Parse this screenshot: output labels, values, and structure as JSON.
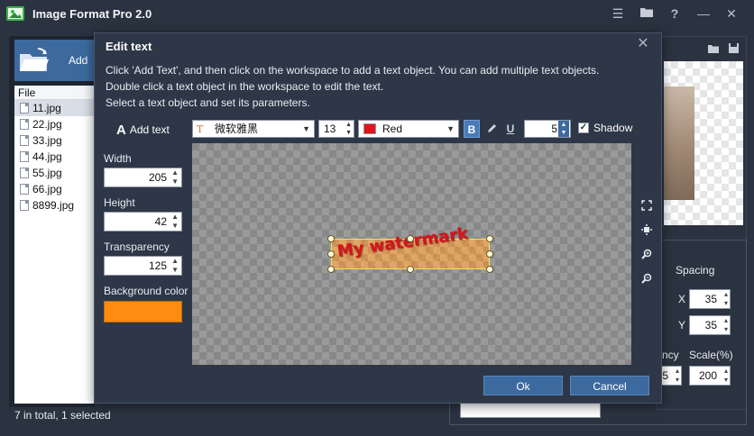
{
  "app": {
    "title": "Image Format Pro 2.0"
  },
  "main": {
    "add_label": "Add",
    "file_header": "File",
    "files": [
      "11.jpg",
      "22.jpg",
      "33.jpg",
      "44.jpg",
      "55.jpg",
      "66.jpg",
      "8899.jpg"
    ],
    "selected_file": "11.jpg",
    "status": "7 in total, 1 selected"
  },
  "right_panel": {
    "spacing_label": "Spacing",
    "x_label": "X",
    "x_value": "35",
    "y_label": "Y",
    "y_value": "35",
    "partial_label": "ncy",
    "partial_value": "5",
    "scale_label": "Scale(%)",
    "scale_value": "200"
  },
  "dialog": {
    "title": "Edit text",
    "instructions": [
      "Click 'Add Text', and then click on the workspace to add a text object. You can add multiple text objects.",
      "Double click a text object in the workspace to edit the text.",
      "Select a text object and set its parameters."
    ],
    "toolbar": {
      "add_text": "Add text",
      "font": "微软雅黑",
      "size": "13",
      "color_name": "Red",
      "color_hex": "#e0141c",
      "bold": "B",
      "underline": "U",
      "shadow_value": "5",
      "shadow_label": "Shadow",
      "shadow_checked": true
    },
    "props": {
      "width_label": "Width",
      "width_value": "205",
      "height_label": "Height",
      "height_value": "42",
      "transparency_label": "Transparency",
      "transparency_value": "125",
      "bg_color_label": "Background color",
      "bg_color_hex": "#ff8c10"
    },
    "watermark_text": "My watermark",
    "ok_label": "Ok",
    "cancel_label": "Cancel"
  }
}
